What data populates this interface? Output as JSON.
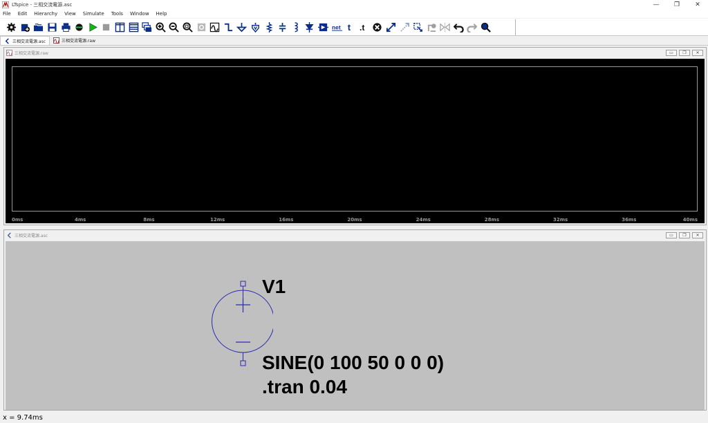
{
  "window": {
    "title": "LTspice - 三相交流電源.asc",
    "minimize": "—",
    "maximize": "❐",
    "close": "✕"
  },
  "menu": [
    "File",
    "Edit",
    "Hierarchy",
    "View",
    "Simulate",
    "Tools",
    "Window",
    "Help"
  ],
  "toolbar": {
    "icons": [
      "control-panel-icon",
      "new-schematic-icon",
      "open-icon",
      "save-icon",
      "print-icon",
      "cut-icon",
      "run-icon",
      "halt-icon",
      "tile-vertical-icon",
      "tile-horizontal-icon",
      "cascade-icon",
      "zoom-in-icon",
      "zoom-out-icon",
      "zoom-fit-icon",
      "zoom-back-icon",
      "autorange-icon",
      "wire-icon",
      "ground-icon",
      "label-net-icon",
      "resistor-icon",
      "capacitor-icon",
      "inductor-icon",
      "diode-icon",
      "component-icon",
      "net-name-icon",
      "text-icon",
      "spice-directive-icon",
      "delete-icon",
      "duplicate-icon",
      "move-icon",
      "drag-icon",
      "paste-icon",
      "mirror-icon",
      "undo-icon",
      "redo-icon",
      "find-icon"
    ],
    "net_label": "net",
    "text_label": "t",
    "directive_label": ".t"
  },
  "tabs": [
    {
      "label": "三相交流電源.asc",
      "active": true
    },
    {
      "label": "三相交流電源.raw",
      "active": false
    }
  ],
  "waveform_window": {
    "title": "三相交流電源.raw",
    "x_ticks": [
      "0ms",
      "4ms",
      "8ms",
      "12ms",
      "16ms",
      "20ms",
      "24ms",
      "28ms",
      "32ms",
      "36ms",
      "40ms"
    ],
    "x_range_ms": [
      0,
      40
    ]
  },
  "schematic_window": {
    "title": "三相交流電源.asc",
    "component": {
      "name": "V1",
      "value": "SINE(0 100 50 0 0 0)"
    },
    "directive": ".tran 0.04"
  },
  "status": {
    "text": "x = 9.74ms"
  }
}
